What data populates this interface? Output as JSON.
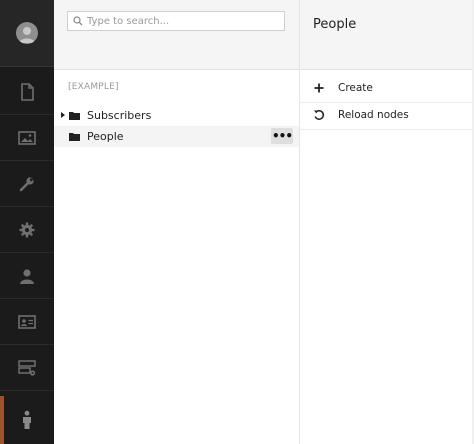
{
  "nav": {
    "items": [
      {
        "icon": "document-icon"
      },
      {
        "icon": "image-icon"
      },
      {
        "icon": "wrench-icon"
      },
      {
        "icon": "gear-icon"
      },
      {
        "icon": "user-icon"
      },
      {
        "icon": "contact-card-icon"
      },
      {
        "icon": "server-settings-icon"
      },
      {
        "icon": "person-icon",
        "active": true
      }
    ],
    "active_accent": "#a0522d"
  },
  "search": {
    "placeholder": "Type to search...",
    "value": ""
  },
  "tree": {
    "root_label": "[EXAMPLE]",
    "nodes": [
      {
        "label": "Subscribers",
        "expandable": true
      },
      {
        "label": "People",
        "selected": true,
        "more_label": "•••"
      }
    ]
  },
  "right_panel": {
    "title": "People",
    "actions": [
      {
        "label": "Create",
        "icon": "plus-icon"
      },
      {
        "label": "Reload nodes",
        "icon": "reload-icon"
      }
    ]
  }
}
